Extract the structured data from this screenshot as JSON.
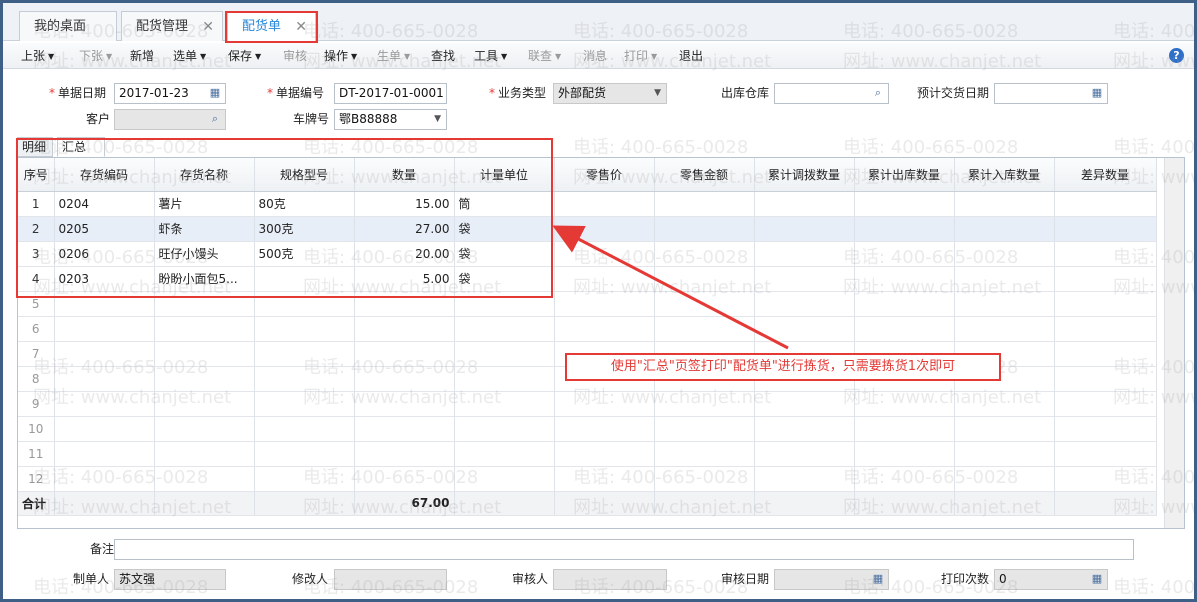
{
  "tabs": [
    {
      "label": "我的桌面",
      "closable": false,
      "active": false
    },
    {
      "label": "配货管理",
      "closable": true,
      "active": false
    },
    {
      "label": "配货单",
      "closable": true,
      "active": true
    }
  ],
  "menu": [
    {
      "label": "上张",
      "dropdown": true,
      "enabled": true
    },
    {
      "label": "下张",
      "dropdown": true,
      "enabled": false
    },
    {
      "label": "新增",
      "dropdown": false,
      "enabled": true
    },
    {
      "label": "选单",
      "dropdown": true,
      "enabled": true
    },
    {
      "label": "保存",
      "dropdown": true,
      "enabled": true
    },
    {
      "label": "审核",
      "dropdown": false,
      "enabled": false
    },
    {
      "label": "操作",
      "dropdown": true,
      "enabled": true
    },
    {
      "label": "生单",
      "dropdown": true,
      "enabled": false
    },
    {
      "label": "查找",
      "dropdown": false,
      "enabled": true
    },
    {
      "label": "工具",
      "dropdown": true,
      "enabled": true
    },
    {
      "label": "联查",
      "dropdown": true,
      "enabled": false
    },
    {
      "label": "消息",
      "dropdown": false,
      "enabled": false
    },
    {
      "label": "打印",
      "dropdown": true,
      "enabled": false
    },
    {
      "label": "退出",
      "dropdown": false,
      "enabled": true
    }
  ],
  "form": {
    "doc_date_label": "单据日期",
    "doc_date": "2017-01-23",
    "doc_no_label": "单据编号",
    "doc_no": "DT-2017-01-0001",
    "biz_type_label": "业务类型",
    "biz_type": "外部配货",
    "warehouse_label": "出库仓库",
    "warehouse": "",
    "expected_date_label": "预计交货日期",
    "expected_date": "",
    "customer_label": "客户",
    "customer": "",
    "plate_label": "车牌号",
    "plate": "鄂B88888"
  },
  "subtabs": {
    "detail": "明细",
    "summary": "汇总"
  },
  "grid": {
    "columns": [
      "序号",
      "存货编码",
      "存货名称",
      "规格型号",
      "数量",
      "计量单位",
      "零售价",
      "零售金额",
      "累计调拨数量",
      "累计出库数量",
      "累计入库数量",
      "差异数量"
    ],
    "rows": [
      {
        "no": "1",
        "code": "0204",
        "name": "薯片",
        "spec": "80克",
        "qty": "15.00",
        "unit": "筒"
      },
      {
        "no": "2",
        "code": "0205",
        "name": "虾条",
        "spec": "300克",
        "qty": "27.00",
        "unit": "袋"
      },
      {
        "no": "3",
        "code": "0206",
        "name": "旺仔小馒头",
        "spec": "500克",
        "qty": "20.00",
        "unit": "袋"
      },
      {
        "no": "4",
        "code": "0203",
        "name": "盼盼小面包5...",
        "spec": "",
        "qty": "5.00",
        "unit": "袋"
      }
    ],
    "empty_rows": [
      "5",
      "6",
      "7",
      "8",
      "9",
      "10",
      "11",
      "12"
    ],
    "total_label": "合计",
    "total_qty": "67.00"
  },
  "footer": {
    "remark_label": "备注",
    "remark": "",
    "maker_label": "制单人",
    "maker": "苏文强",
    "modifier_label": "修改人",
    "modifier": "",
    "auditor_label": "审核人",
    "auditor": "",
    "audit_date_label": "审核日期",
    "audit_date": "",
    "print_count_label": "打印次数",
    "print_count": "0"
  },
  "annotation": "使用\"汇总\"页签打印\"配货单\"进行拣货，只需要拣货1次即可",
  "watermark": {
    "phone": "电话: 400-665-0028",
    "site": "网址: www.chanjet.net"
  },
  "colors": {
    "accent": "#2b88d8",
    "highlight": "#e53935",
    "frame": "#3e5f86"
  }
}
